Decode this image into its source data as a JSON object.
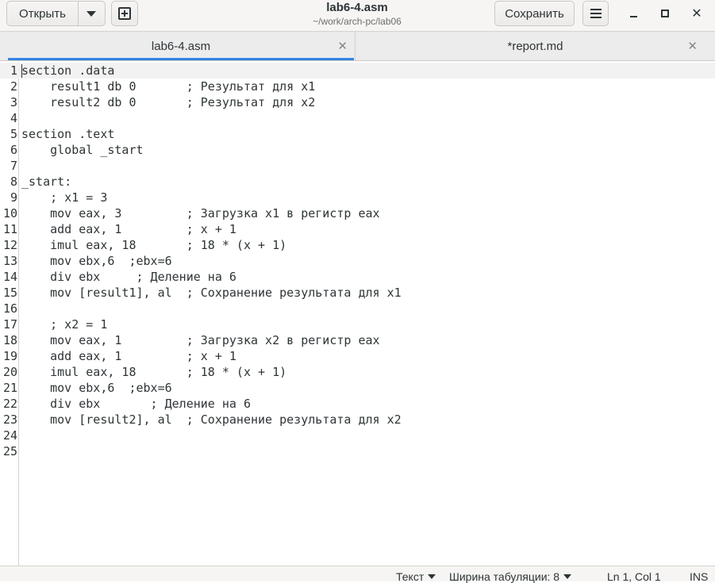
{
  "header": {
    "open_label": "Открыть",
    "title": "lab6-4.asm",
    "path": "~/work/arch-pc/lab06",
    "save_label": "Сохранить"
  },
  "tabs": [
    {
      "label": "lab6-4.asm",
      "active": true
    },
    {
      "label": "*report.md",
      "active": false
    }
  ],
  "editor": {
    "current_line": 1,
    "lines": [
      {
        "n": "1",
        "text": "section .data"
      },
      {
        "n": "2",
        "text": "    result1 db 0       ; Результат для x1"
      },
      {
        "n": "3",
        "text": "    result2 db 0       ; Результат для x2"
      },
      {
        "n": "4",
        "text": ""
      },
      {
        "n": "5",
        "text": "section .text"
      },
      {
        "n": "6",
        "text": "    global _start"
      },
      {
        "n": "7",
        "text": ""
      },
      {
        "n": "8",
        "text": "_start:"
      },
      {
        "n": "9",
        "text": "    ; x1 = 3"
      },
      {
        "n": "10",
        "text": "    mov eax, 3         ; Загрузка x1 в регистр eax"
      },
      {
        "n": "11",
        "text": "    add eax, 1         ; x + 1"
      },
      {
        "n": "12",
        "text": "    imul eax, 18       ; 18 * (x + 1)"
      },
      {
        "n": "13",
        "text": "    mov ebx,6  ;ebx=6"
      },
      {
        "n": "14",
        "text": "    div ebx     ; Деление на 6"
      },
      {
        "n": "15",
        "text": "    mov [result1], al  ; Сохранение результата для x1"
      },
      {
        "n": "16",
        "text": ""
      },
      {
        "n": "17",
        "text": "    ; x2 = 1"
      },
      {
        "n": "18",
        "text": "    mov eax, 1         ; Загрузка x2 в регистр eax"
      },
      {
        "n": "19",
        "text": "    add eax, 1         ; x + 1"
      },
      {
        "n": "20",
        "text": "    imul eax, 18       ; 18 * (x + 1)"
      },
      {
        "n": "21",
        "text": "    mov ebx,6  ;ebx=6"
      },
      {
        "n": "22",
        "text": "    div ebx       ; Деление на 6"
      },
      {
        "n": "23",
        "text": "    mov [result2], al  ; Сохранение результата для x2"
      },
      {
        "n": "24",
        "text": ""
      },
      {
        "n": "25",
        "text": ""
      }
    ]
  },
  "status": {
    "language": "Текст",
    "tab_width": "Ширина табуляции: 8",
    "position": "Ln 1, Col 1",
    "mode": "INS"
  },
  "colors": {
    "accent": "#3584e4",
    "headerbar": "#f6f5f4",
    "current_line": "#f2f2f2"
  }
}
